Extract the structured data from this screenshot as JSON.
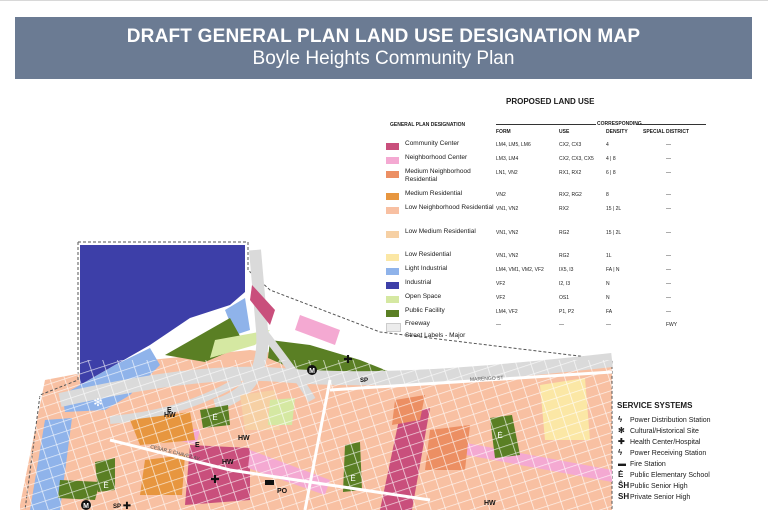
{
  "banner": {
    "title": "DRAFT GENERAL PLAN LAND USE DESIGNATION MAP",
    "subtitle": "Boyle Heights Community Plan"
  },
  "legend": {
    "title": "PROPOSED LAND USE",
    "col_designation": "GENERAL PLAN DESIGNATION",
    "col_corresponding": "CORRESPONDING",
    "col_form": "FORM",
    "col_use": "USE",
    "col_density": "DENSITY",
    "col_special": "SPECIAL DISTRICT",
    "rows": [
      {
        "name": "Community Center",
        "form": "LM4, LM5, LM6",
        "use": "CX2, CX3",
        "density": "4",
        "special": "—",
        "color": "#c94f7c"
      },
      {
        "name": "Neighborhood Center",
        "form": "LM3, LM4",
        "use": "CX2, CX3, CX5",
        "density": "4 | 8",
        "special": "—",
        "color": "#f4a9d2"
      },
      {
        "name": "Medium Neighborhood Residential",
        "form": "LN1, VN2",
        "use": "RX1, RX2",
        "density": "6 | 8",
        "special": "—",
        "color": "#ec8f63"
      },
      {
        "name": "Medium Residential",
        "form": "VN2",
        "use": "RX2, RG2",
        "density": "8",
        "special": "—",
        "color": "#e7963f"
      },
      {
        "name": "Low Neighborhood Residential",
        "form": "VN1, VN2",
        "use": "RX2",
        "density": "15 | 2L",
        "special": "—",
        "color": "#f8c0a2"
      },
      {
        "name": "Low Medium Residential",
        "form": "VN1, VN2",
        "use": "RG2",
        "density": "15 | 2L",
        "special": "—",
        "color": "#f6d0a4"
      },
      {
        "name": "Low Residential",
        "form": "VN1, VN2",
        "use": "RG2",
        "density": "1L",
        "special": "—",
        "color": "#fbe7a5"
      },
      {
        "name": "Light Industrial",
        "form": "LM4, VM1, VM2, VF2",
        "use": "IX5, I3",
        "density": "FA | N",
        "special": "—",
        "color": "#8fb3ea"
      },
      {
        "name": "Industrial",
        "form": "VF2",
        "use": "I2, I3",
        "density": "N",
        "special": "—",
        "color": "#3d3fa8"
      },
      {
        "name": "Open Space",
        "form": "VF2",
        "use": "OS1",
        "density": "N",
        "special": "—",
        "color": "#d5e8a2"
      },
      {
        "name": "Public Facility",
        "form": "LM4, VF2",
        "use": "P1, P2",
        "density": "FA",
        "special": "—",
        "color": "#5a7f24"
      },
      {
        "name": "Freeway",
        "form": "—",
        "use": "—",
        "density": "—",
        "special": "FWY",
        "color": "#ececec"
      },
      {
        "name": "Street Labels - Major",
        "form": "",
        "use": "",
        "density": "",
        "special": "",
        "color": "#ffffff"
      }
    ]
  },
  "services": {
    "title": "SERVICE SYSTEMS",
    "items": [
      {
        "icon": "ϟ",
        "label": "Power Distribution Station"
      },
      {
        "icon": "✻",
        "label": "Cultural/Historical Site"
      },
      {
        "icon": "✚",
        "label": "Health Center/Hospital"
      },
      {
        "icon": "ϟ",
        "label": "Power Receiving Station"
      },
      {
        "icon": "▬",
        "label": "Fire Station"
      },
      {
        "icon": "Ė",
        "label": "Public Elementary School"
      },
      {
        "icon": "ŜH",
        "label": "Public Senior High"
      },
      {
        "icon": "SH",
        "label": "Private Senior High"
      }
    ]
  },
  "map_labels": {
    "hw1": "HW",
    "hw2": "HW",
    "hw3": "HW",
    "hw4": "HW",
    "po": "PO",
    "sp1": "SP",
    "sp2": "SP",
    "e1": "E",
    "e2": "E",
    "m1": "M",
    "m2": "M",
    "street1": "MARENGO ST",
    "street2": "CESAR E CHAVEZ AV"
  }
}
